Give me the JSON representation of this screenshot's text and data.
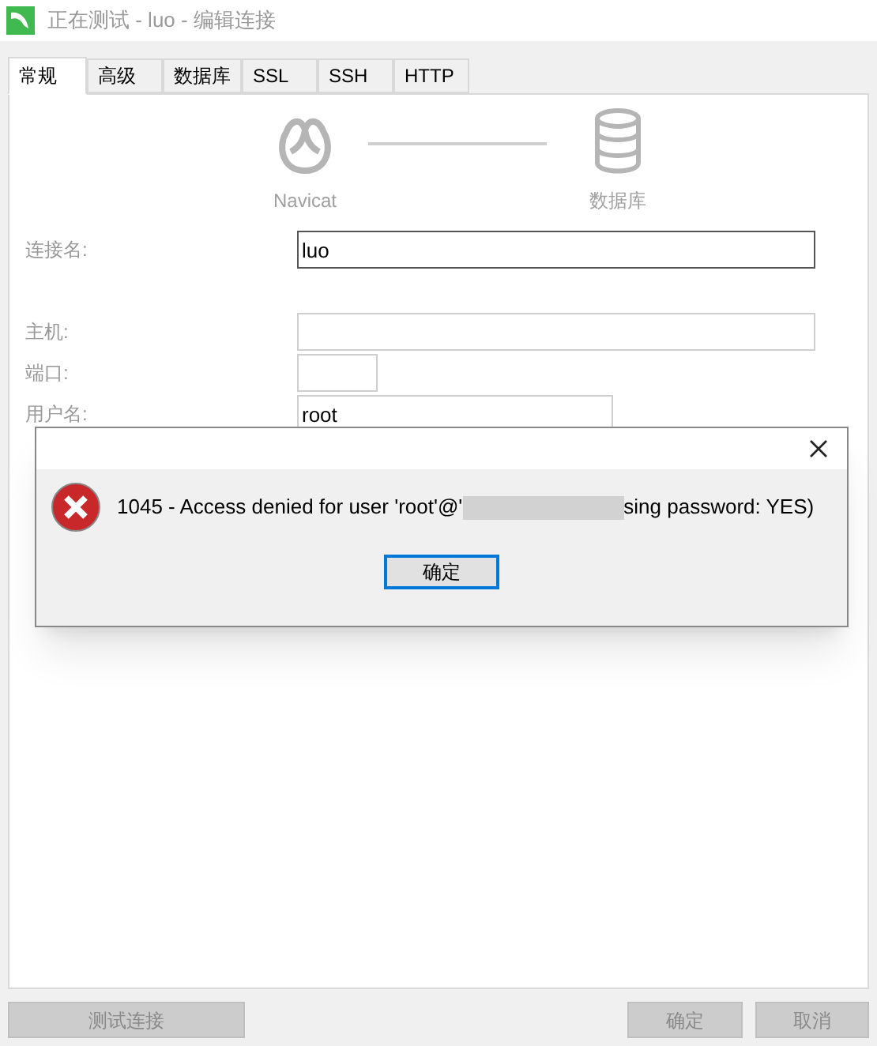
{
  "window": {
    "title": "正在测试 - luo - 编辑连接"
  },
  "tabs": [
    {
      "label": "常规",
      "selected": true
    },
    {
      "label": "高级",
      "selected": false
    },
    {
      "label": "数据库",
      "selected": false
    },
    {
      "label": "SSL",
      "selected": false
    },
    {
      "label": "SSH",
      "selected": false
    },
    {
      "label": "HTTP",
      "selected": false
    }
  ],
  "diagram": {
    "source": "Navicat",
    "target": "数据库"
  },
  "fields": [
    {
      "label": "连接名:",
      "value": "luo",
      "focused": true,
      "kind": "long"
    },
    {
      "label": "主机:",
      "focused": false,
      "kind": "long"
    },
    {
      "label": "端口:",
      "focused": false,
      "kind": "short"
    },
    {
      "label": "用户名:",
      "value": "root",
      "focused": false,
      "kind": "medium"
    }
  ],
  "dialog": {
    "message_start": "1045 - Access denied for user 'root'@'",
    "message_end": "sing password: YES)",
    "ok": "确定"
  },
  "buttons": [
    {
      "label": "测试连接",
      "disabled": true
    },
    {
      "label": "确定",
      "disabled": true
    },
    {
      "label": "取消",
      "disabled": true
    }
  ]
}
